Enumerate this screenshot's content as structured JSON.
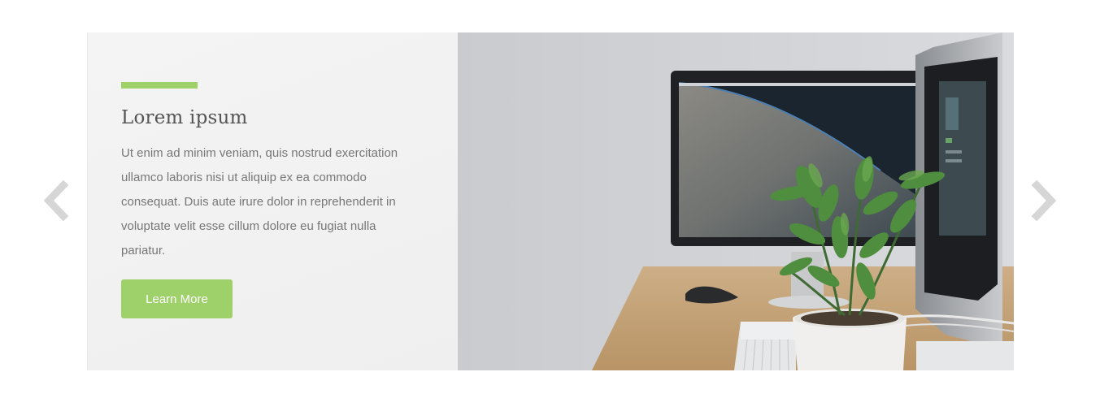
{
  "slide": {
    "title": "Lorem ipsum",
    "body": "Ut enim ad minim veniam, quis nostrud exercitation ullamco laboris nisi ut aliquip ex ea commodo consequat. Duis aute irure dolor in reprehenderit in voluptate velit esse cillum dolore eu fugiat nulla pariatur.",
    "button_label": "Learn More"
  },
  "navigation": {
    "prev_icon": "chevron-left-icon",
    "next_icon": "chevron-right-icon"
  },
  "colors": {
    "accent": "#9fd16b",
    "arrow": "#d6d6d6",
    "panel_background": "#f3f3f3"
  }
}
